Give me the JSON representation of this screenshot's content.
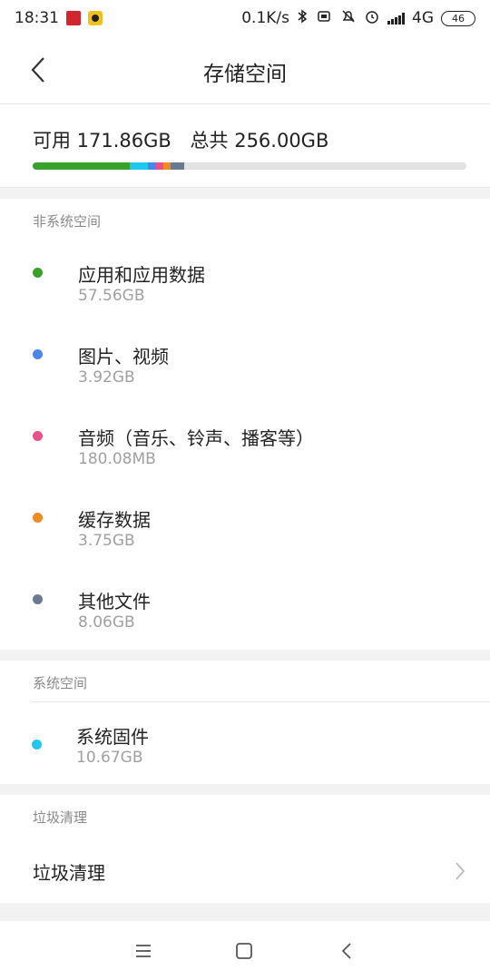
{
  "status_bar": {
    "time": "18:31",
    "net_speed": "0.1K/s",
    "network_type": "4G",
    "battery": "46",
    "icons": [
      "app-notification-icon",
      "app-notification-icon-2",
      "bluetooth-icon",
      "vibrate-icon",
      "mute-icon",
      "alarm-icon",
      "signal-icon",
      "battery-icon"
    ]
  },
  "header": {
    "title": "存储空间"
  },
  "summary": {
    "available": "可用 171.86GB",
    "total": "总共 256.00GB",
    "usage_colors": [
      "#3aa02c",
      "#1ec8ef",
      "#4a86e8",
      "#e8508a",
      "#f08a24",
      "#6b7b8f"
    ]
  },
  "non_system": {
    "header": "非系统空间",
    "items": [
      {
        "label": "应用和应用数据",
        "size": "57.56GB",
        "color": "#3aa02c"
      },
      {
        "label": "图片、视频",
        "size": "3.92GB",
        "color": "#4a86e8"
      },
      {
        "label": "音频（音乐、铃声、播客等）",
        "size": "180.08MB",
        "color": "#e8508a"
      },
      {
        "label": "缓存数据",
        "size": "3.75GB",
        "color": "#f08a24"
      },
      {
        "label": "其他文件",
        "size": "8.06GB",
        "color": "#6b7b8f"
      }
    ]
  },
  "system": {
    "header": "系统空间",
    "items": [
      {
        "label": "系统固件",
        "size": "10.67GB",
        "color": "#1ec8ef"
      }
    ]
  },
  "cleanup": {
    "header": "垃圾清理",
    "item_label": "垃圾清理"
  },
  "nav_bar": {
    "buttons": [
      "menu-icon",
      "home-icon",
      "back-icon"
    ]
  }
}
